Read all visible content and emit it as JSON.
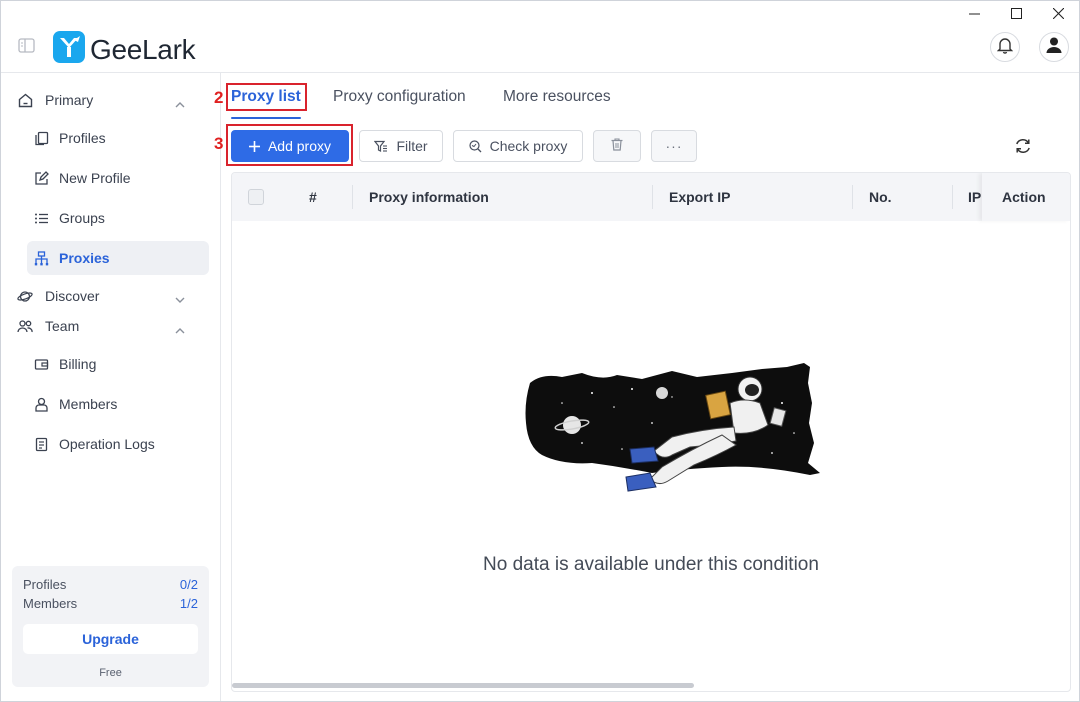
{
  "app": {
    "name": "GeeLark",
    "brand_color": "#2e6be6",
    "logo_icon": "geelark-y-logo-icon"
  },
  "window_controls": [
    "minimize-icon",
    "maximize-icon",
    "close-icon"
  ],
  "header": {
    "notification_icon": "bell-icon",
    "profile_icon": "user-icon"
  },
  "sidebar": {
    "groups": [
      {
        "label": "Primary",
        "icon": "home-icon",
        "expanded": true,
        "items": [
          {
            "label": "Profiles",
            "icon": "profiles-icon"
          },
          {
            "label": "New Profile",
            "icon": "edit-icon"
          },
          {
            "label": "Groups",
            "icon": "list-icon"
          },
          {
            "label": "Proxies",
            "icon": "network-icon",
            "active": true
          }
        ]
      },
      {
        "label": "Discover",
        "icon": "planet-icon",
        "expanded": false,
        "items": []
      },
      {
        "label": "Team",
        "icon": "team-icon",
        "expanded": true,
        "items": [
          {
            "label": "Billing",
            "icon": "wallet-icon"
          },
          {
            "label": "Members",
            "icon": "member-icon"
          },
          {
            "label": "Operation Logs",
            "icon": "log-icon"
          }
        ]
      }
    ],
    "usage": {
      "profiles_label": "Profiles",
      "profiles_value": "0/2",
      "members_label": "Members",
      "members_value": "1/2",
      "upgrade_label": "Upgrade",
      "plan": "Free"
    }
  },
  "tabs": [
    {
      "label": "Proxy list",
      "active": true
    },
    {
      "label": "Proxy configuration"
    },
    {
      "label": "More resources"
    }
  ],
  "annotations": {
    "tab_marker": "2",
    "button_marker": "3"
  },
  "toolbar": {
    "add_label": "Add proxy",
    "filter_label": "Filter",
    "check_label": "Check proxy",
    "more_label": "···",
    "delete_icon": "trash-icon",
    "refresh_icon": "refresh-icon"
  },
  "table": {
    "columns": [
      "#",
      "Proxy information",
      "Export IP",
      "No.",
      "IP",
      "Action"
    ],
    "rows": [],
    "empty_text": "No data is available under this condition"
  }
}
